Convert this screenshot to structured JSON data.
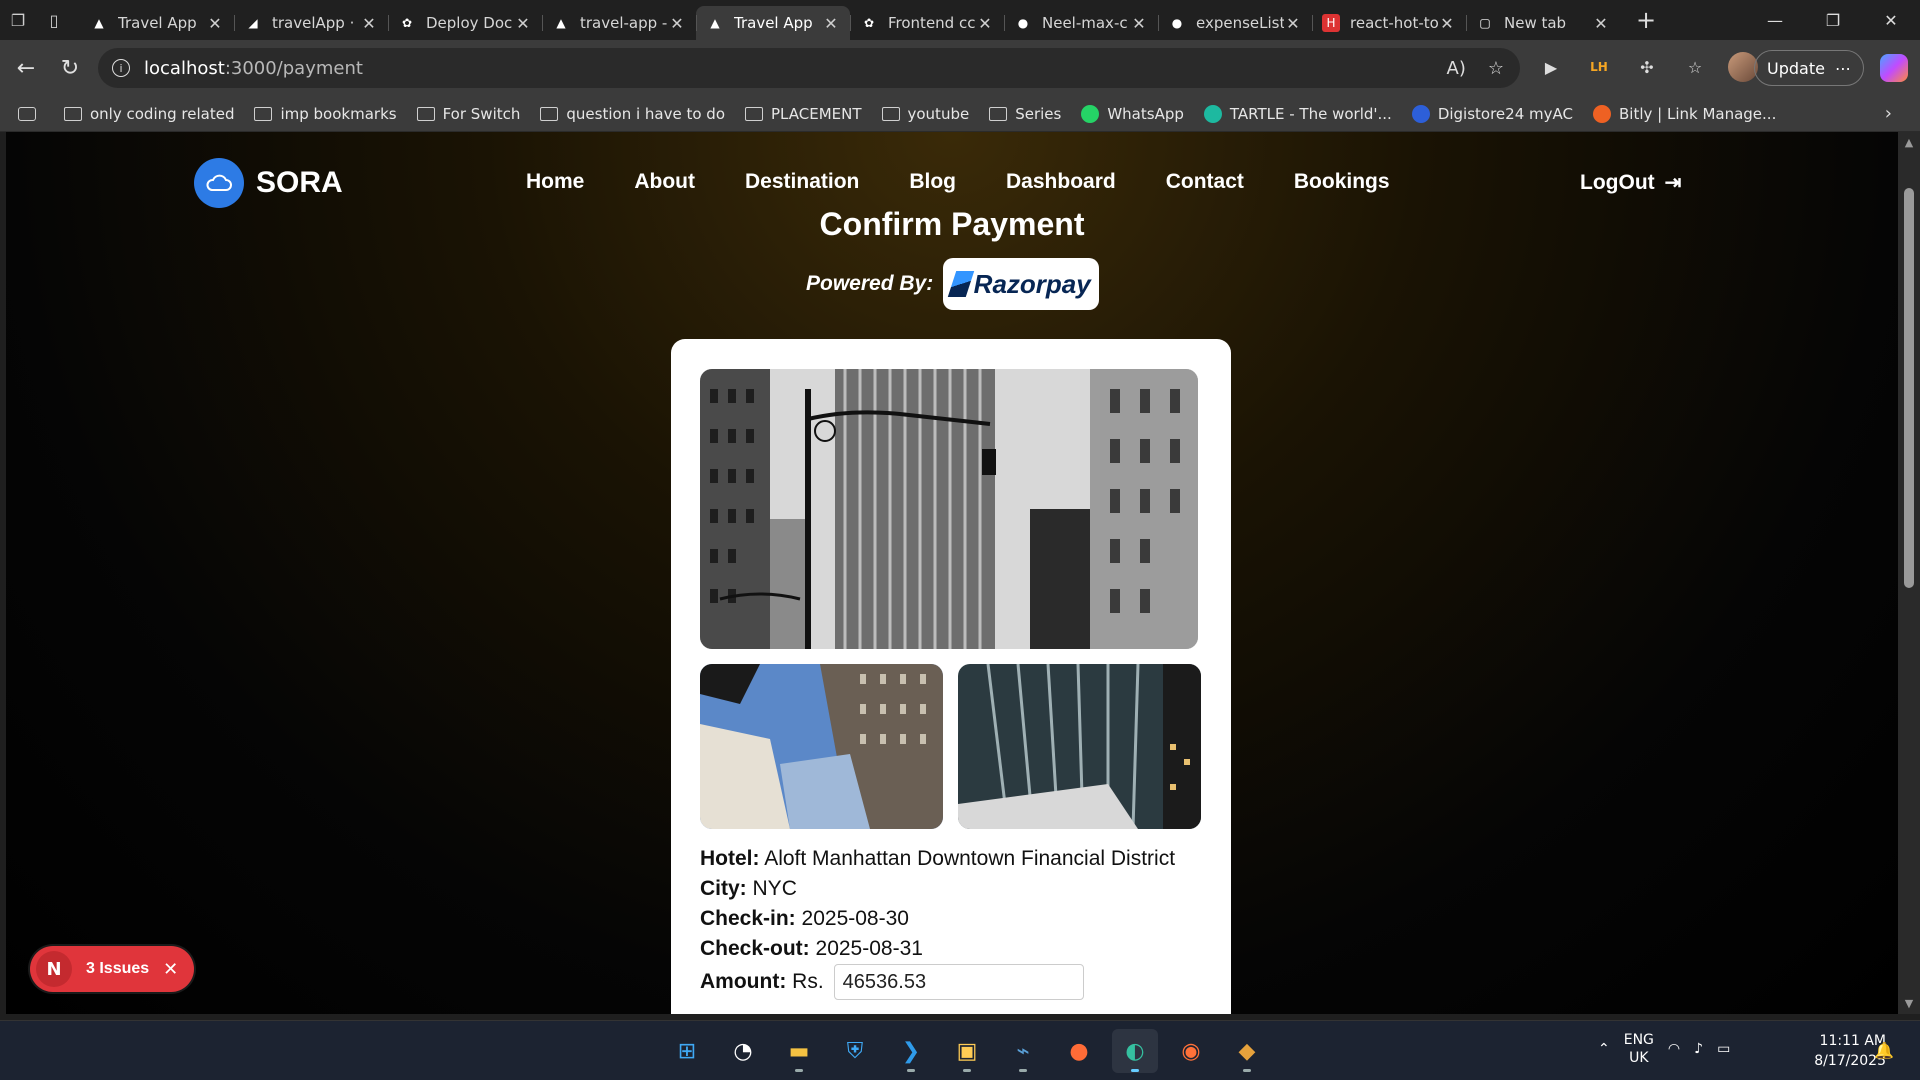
{
  "browser": {
    "tabs": [
      {
        "title": "Travel App",
        "icon": "vercel-icon"
      },
      {
        "title": "travelApp ·",
        "icon": "render-icon"
      },
      {
        "title": "Deploy Doc",
        "icon": "chatgpt-icon"
      },
      {
        "title": "travel-app -",
        "icon": "vercel-icon"
      },
      {
        "title": "Travel App",
        "icon": "vercel-icon",
        "active": true
      },
      {
        "title": "Frontend cc",
        "icon": "chatgpt-icon"
      },
      {
        "title": "Neel-max-c",
        "icon": "github-icon"
      },
      {
        "title": "expenseList",
        "icon": "github-icon"
      },
      {
        "title": "react-hot-to",
        "icon": "hot-toast-icon"
      },
      {
        "title": "New tab",
        "icon": "newtab-icon"
      }
    ],
    "url_host": "localhost",
    "url_path": ":3000/payment",
    "update_label": "Update",
    "bookmarks": [
      {
        "label": "only coding  related"
      },
      {
        "label": "imp bookmarks"
      },
      {
        "label": "For Switch"
      },
      {
        "label": "question i have to do"
      },
      {
        "label": "PLACEMENT"
      },
      {
        "label": "youtube"
      },
      {
        "label": "Series"
      },
      {
        "label": "WhatsApp"
      },
      {
        "label": "TARTLE - The world'..."
      },
      {
        "label": "Digistore24 myAC"
      },
      {
        "label": "Bitly | Link Manage..."
      }
    ]
  },
  "site": {
    "brand": "SORA",
    "nav": [
      "Home",
      "About",
      "Destination",
      "Blog",
      "Dashboard",
      "Contact",
      "Bookings"
    ],
    "logout": "LogOut"
  },
  "payment": {
    "title": "Confirm Payment",
    "powered_by": "Powered By:",
    "provider": "Razorpay",
    "hotel_label": "Hotel:",
    "hotel": "Aloft Manhattan Downtown Financial District",
    "city_label": "City:",
    "city": "NYC",
    "checkin_label": "Check-in:",
    "checkin": "2025-08-30",
    "checkout_label": "Check-out:",
    "checkout": "2025-08-31",
    "amount_label": "Amount:",
    "currency": "Rs.",
    "amount": "46536.53"
  },
  "devtools": {
    "badge_letter": "N",
    "issues": "3 Issues"
  },
  "taskbar": {
    "lang": "ENG",
    "region": "UK",
    "time": "11:11 AM",
    "date": "8/17/2025"
  }
}
